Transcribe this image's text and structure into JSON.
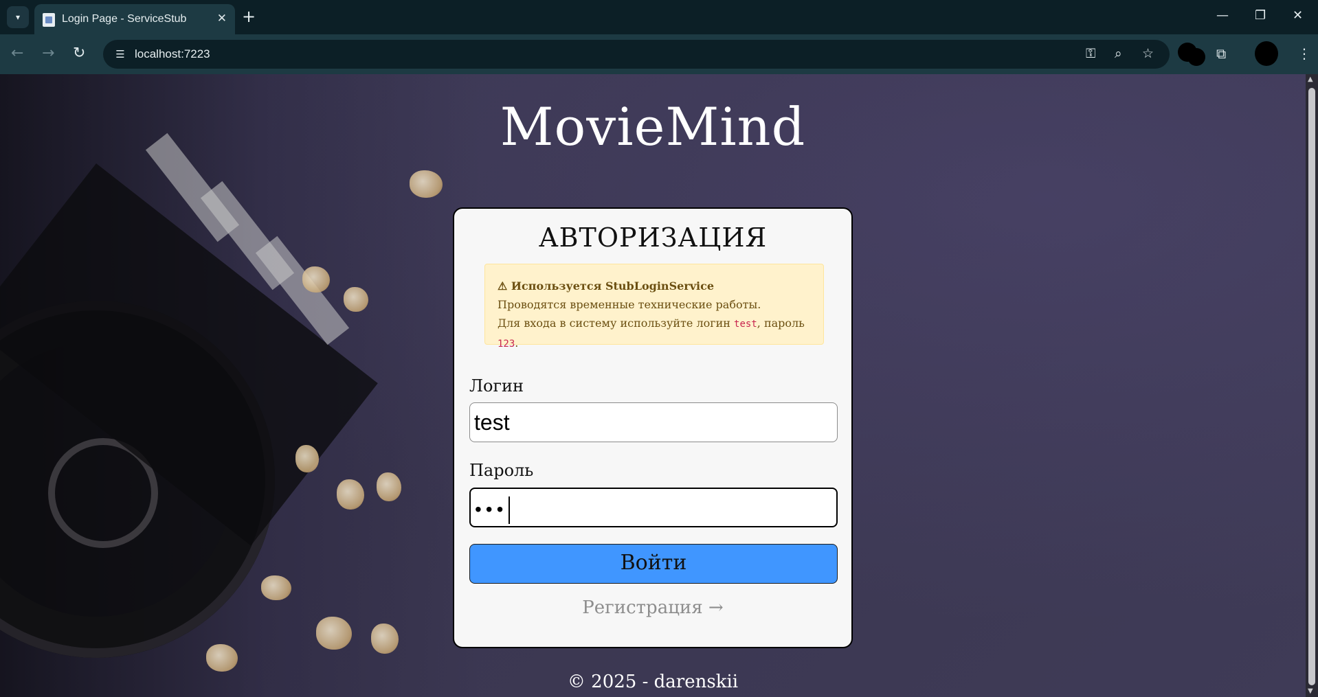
{
  "browser": {
    "tab_title": "Login Page - ServiceStub",
    "url": "localhost:7223",
    "icons": {
      "tab_search": "chevron-down-icon",
      "new_tab": "plus-icon",
      "back": "arrow-left-icon",
      "forward": "arrow-right-icon",
      "reload": "reload-icon",
      "site_info": "tune-icon",
      "password": "key-icon",
      "zoom": "zoom-icon",
      "bookmark": "star-icon",
      "extensions": "puzzle-icon",
      "menu": "kebab-menu-icon"
    }
  },
  "page": {
    "brand": "MovieMind",
    "card": {
      "title": "АВТОРИЗАЦИЯ",
      "alert": {
        "heading": "⚠ Используется StubLoginService",
        "line1": "Проводятся временные технические работы.",
        "line2_prefix": "Для входа в систему используйте логин ",
        "login_code": "test",
        "line2_middle": ", пароль ",
        "password_code": "123",
        "line2_suffix": "."
      },
      "login_label": "Логин",
      "login_value": "test",
      "password_label": "Пароль",
      "password_mask": "•••",
      "submit_label": "Войти",
      "register_link": "Регистрация →"
    },
    "footer": "© 2025 - darenskii"
  },
  "colors": {
    "button": "#4096ff",
    "alert_bg": "#fff2cc",
    "alert_text": "#6b4f11",
    "code_text": "#c7254e"
  }
}
